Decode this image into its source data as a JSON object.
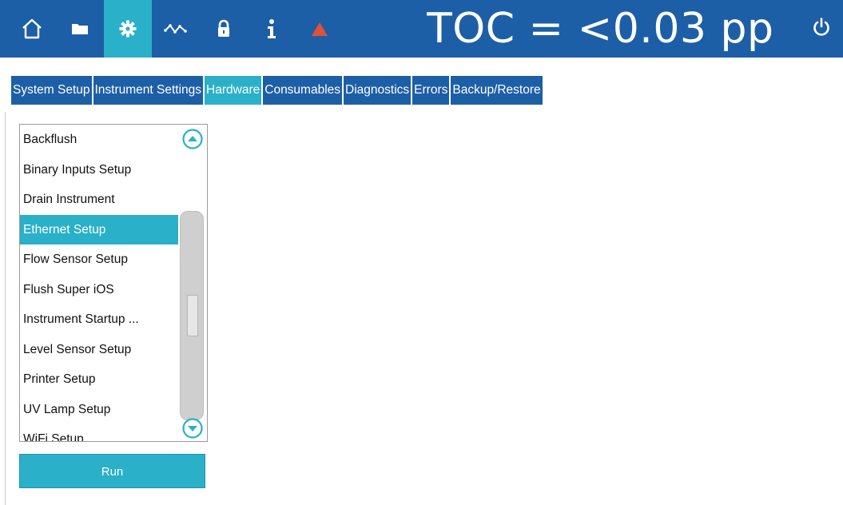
{
  "topbar": {
    "toc_text": "TOC = <0.03 pp",
    "colors": {
      "bar": "#1d5fa6",
      "active": "#2ab0c8",
      "alarm": "#e0503a"
    },
    "icons": [
      "home-icon",
      "folder-icon",
      "gear-icon",
      "trend-icon",
      "lock-icon",
      "info-icon",
      "alarm-icon",
      "power-icon"
    ]
  },
  "tabs": [
    {
      "label": "System Setup"
    },
    {
      "label": "Instrument Settings"
    },
    {
      "label": "Hardware",
      "active": true
    },
    {
      "label": "Consumables"
    },
    {
      "label": "Diagnostics"
    },
    {
      "label": "Errors"
    },
    {
      "label": "Backup/Restore"
    }
  ],
  "hardware_list": {
    "items": [
      "Backflush",
      "Binary Inputs Setup",
      "Drain Instrument",
      "Ethernet Setup",
      "Flow Sensor Setup",
      "Flush Super iOS",
      "Instrument Startup ...",
      "Level Sensor Setup",
      "Printer Setup",
      "UV Lamp Setup",
      "WiFi Setup"
    ],
    "selected": "Ethernet Setup"
  },
  "actions": {
    "run_label": "Run"
  }
}
